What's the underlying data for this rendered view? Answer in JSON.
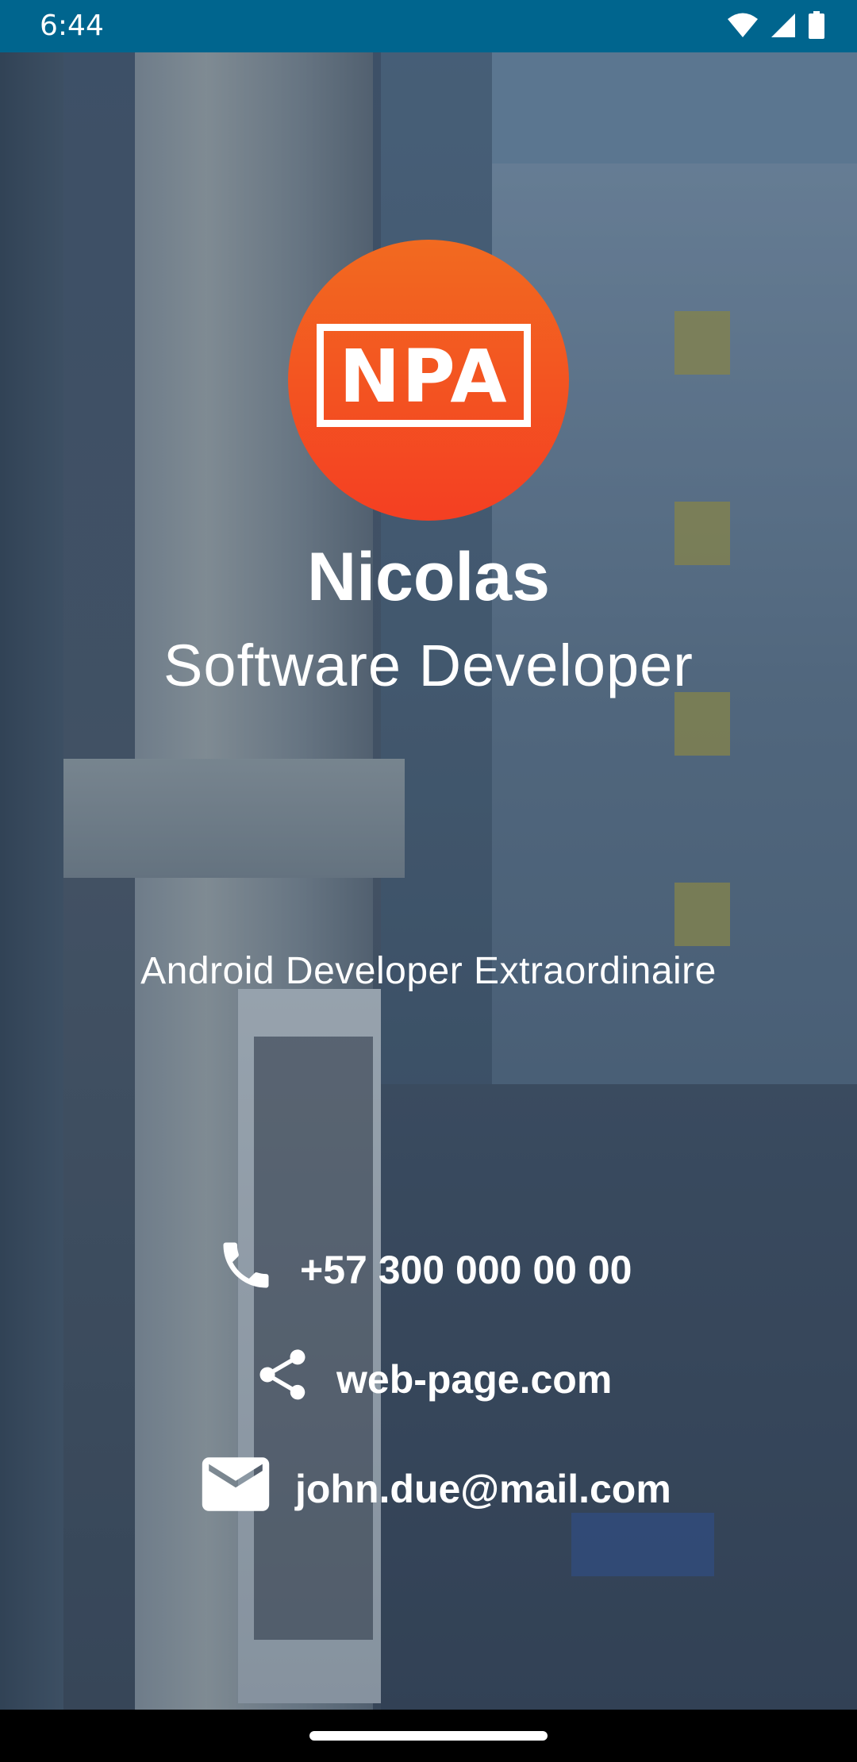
{
  "status_bar": {
    "time": "6:44",
    "icons": [
      "wifi-icon",
      "signal-icon",
      "battery-icon"
    ],
    "background_color": "#00658e"
  },
  "card": {
    "logo_text": "NPA",
    "logo_colors": [
      "#f26a20",
      "#f43f22"
    ],
    "name": "Nicolas",
    "title": "Software Developer",
    "tagline": "Android Developer Extraordinaire"
  },
  "contacts": {
    "phone": {
      "icon": "phone-icon",
      "text": "+57 300 000 00 00"
    },
    "web": {
      "icon": "share-icon",
      "text": "web-page.com"
    },
    "email": {
      "icon": "mail-icon",
      "text": "john.due@mail.com"
    }
  },
  "nav_bar": {
    "background_color": "#000000"
  }
}
